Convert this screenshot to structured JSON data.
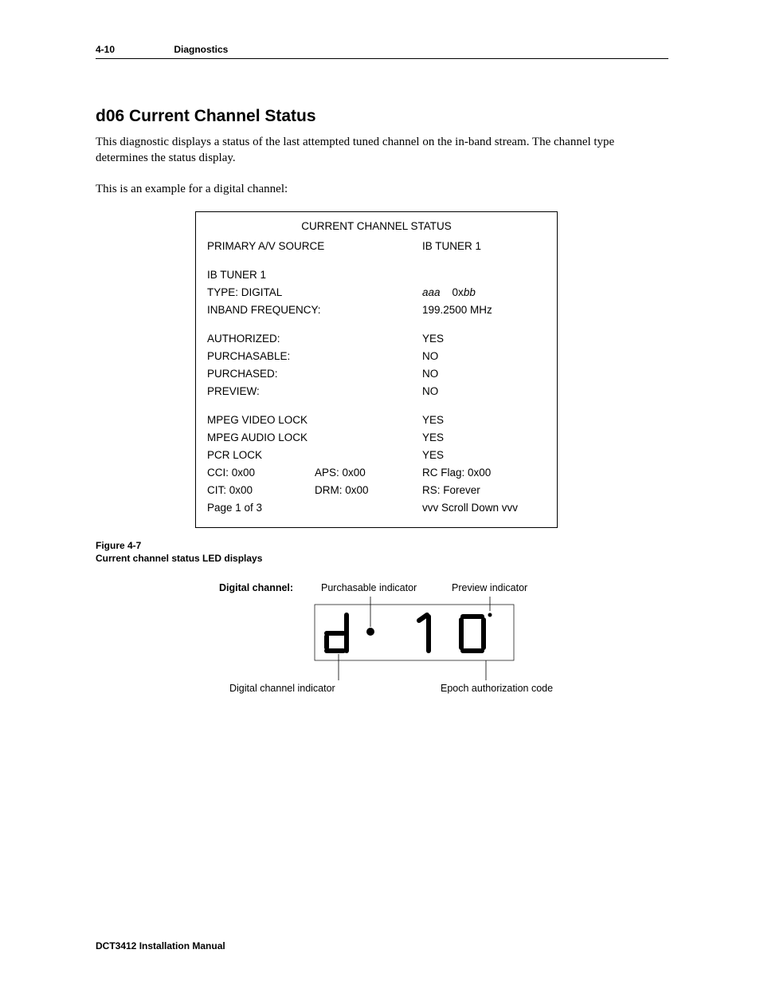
{
  "header": {
    "page_num": "4-10",
    "section": "Diagnostics"
  },
  "title": "d06 Current Channel Status",
  "para1": "This diagnostic displays a status of the last attempted tuned channel on the in-band stream. The channel type determines the status display.",
  "para2": "This is an example for a digital channel:",
  "box": {
    "title": "CURRENT CHANNEL STATUS",
    "primary_label": "PRIMARY A/V SOURCE",
    "primary_val": "IB TUNER 1",
    "tuner": "IB TUNER 1",
    "type_label": "TYPE: DIGITAL",
    "type_val_a": "aaa",
    "type_val_b": "0x",
    "type_val_c": "bb",
    "freq_label": "INBAND FREQUENCY:",
    "freq_val": "199.2500 MHz",
    "auth_label": "AUTHORIZED:",
    "auth_val": "YES",
    "purch_label": "PURCHASABLE:",
    "purch_val": "NO",
    "purchd_label": "PURCHASED:",
    "purchd_val": "NO",
    "prev_label": "PREVIEW:",
    "prev_val": "NO",
    "mvl_label": "MPEG VIDEO LOCK",
    "mvl_val": "YES",
    "mal_label": "MPEG AUDIO LOCK",
    "mal_val": "YES",
    "pcr_label": "PCR LOCK",
    "pcr_val": "YES",
    "cci": "CCI: 0x00",
    "aps": "APS: 0x00",
    "rcflag": "RC Flag: 0x00",
    "cit": "CIT: 0x00",
    "drm": "DRM: 0x00",
    "rs": "RS: Forever",
    "page": "Page 1 of 3",
    "scroll": "vvv  Scroll Down  vvv"
  },
  "fig_num": "Figure 4-7",
  "fig_cap": "Current channel status LED displays",
  "led": {
    "digital": "Digital channel:",
    "purchasable": "Purchasable indicator",
    "preview": "Preview indicator",
    "dc_ind": "Digital channel indicator",
    "epoch": "Epoch authorization code"
  },
  "footer": "DCT3412 Installation Manual"
}
